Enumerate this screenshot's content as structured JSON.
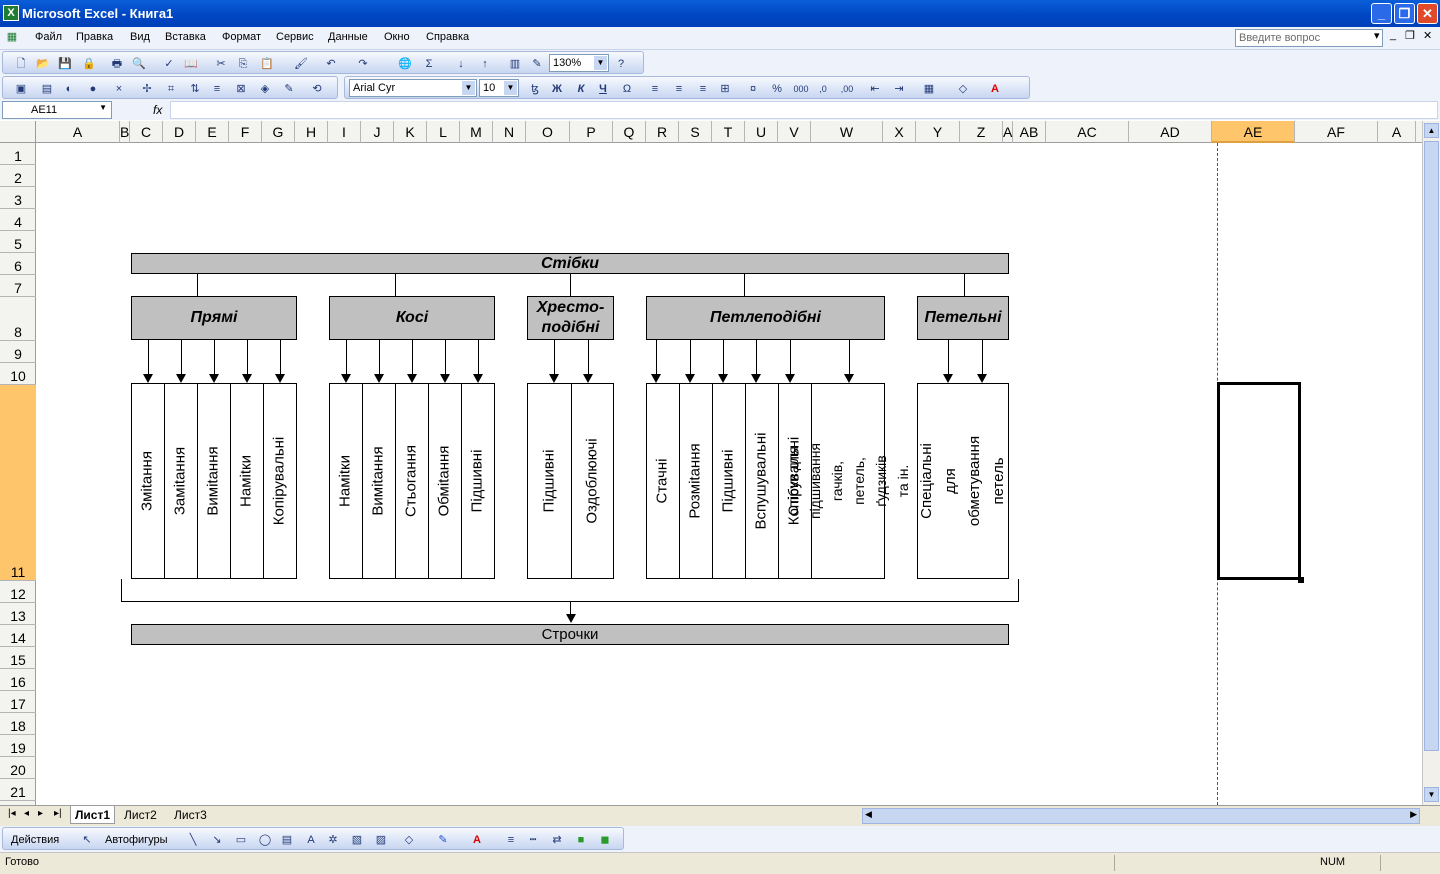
{
  "window": {
    "title": "Microsoft Excel - Книга1"
  },
  "menu": {
    "items": [
      "Файл",
      "Правка",
      "Вид",
      "Вставка",
      "Формат",
      "Сервис",
      "Данные",
      "Окно",
      "Справка"
    ],
    "ask_placeholder": "Введите вопрос"
  },
  "toolbar": {
    "zoom": "130%",
    "font": "Arial Cyr",
    "size": "10"
  },
  "formula": {
    "cell_ref": "AE11",
    "fx": "fx",
    "content": ""
  },
  "columns": [
    "A",
    "B",
    "C",
    "D",
    "E",
    "F",
    "G",
    "H",
    "I",
    "J",
    "K",
    "L",
    "M",
    "N",
    "O",
    "P",
    "Q",
    "R",
    "S",
    "T",
    "U",
    "V",
    "W",
    "X",
    "Y",
    "Z",
    "A",
    "AB",
    "AC",
    "AD",
    "AE",
    "AF",
    "A"
  ],
  "selected_column": "AE",
  "rows": [
    "1",
    "2",
    "3",
    "4",
    "5",
    "6",
    "7",
    "8",
    "9",
    "10",
    "11",
    "12",
    "13",
    "14",
    "15",
    "16",
    "17",
    "18",
    "19",
    "20",
    "21"
  ],
  "selected_row": "11",
  "diagram": {
    "top": "Стібки",
    "groups": [
      {
        "title": "Прямі",
        "leaves": [
          "Зміtання",
          "Заміtання",
          "Виміtання",
          "Наміtки",
          "Копірувальні"
        ]
      },
      {
        "title": "Косі",
        "leaves": [
          "Наміtки",
          "Виміtання",
          "Стьогання",
          "Обміtання",
          "Підшивні"
        ]
      },
      {
        "title": "Хресто-\nподібні",
        "leaves": [
          "Підшивні",
          "Оздоблюючі"
        ]
      },
      {
        "title": "Петлеподібні",
        "leaves": [
          "Стачні",
          "Розміtання",
          "Підшивні",
          "Вспушувальні",
          "Копірувальні",
          "Стібки для підшивання\nгачків, петель, ґудзиків\nта ін."
        ]
      },
      {
        "title": "Петельні",
        "leaves": [
          "Спеціальні для\nобметування петель"
        ]
      }
    ],
    "bottom": "Строчки"
  },
  "sheets": [
    "Лист1",
    "Лист2",
    "Лист3"
  ],
  "active_sheet": "Лист1",
  "drawbar": {
    "actions": "Действия",
    "autoshapes": "Автофигуры"
  },
  "status": {
    "left": "Готово",
    "num": "NUM"
  }
}
